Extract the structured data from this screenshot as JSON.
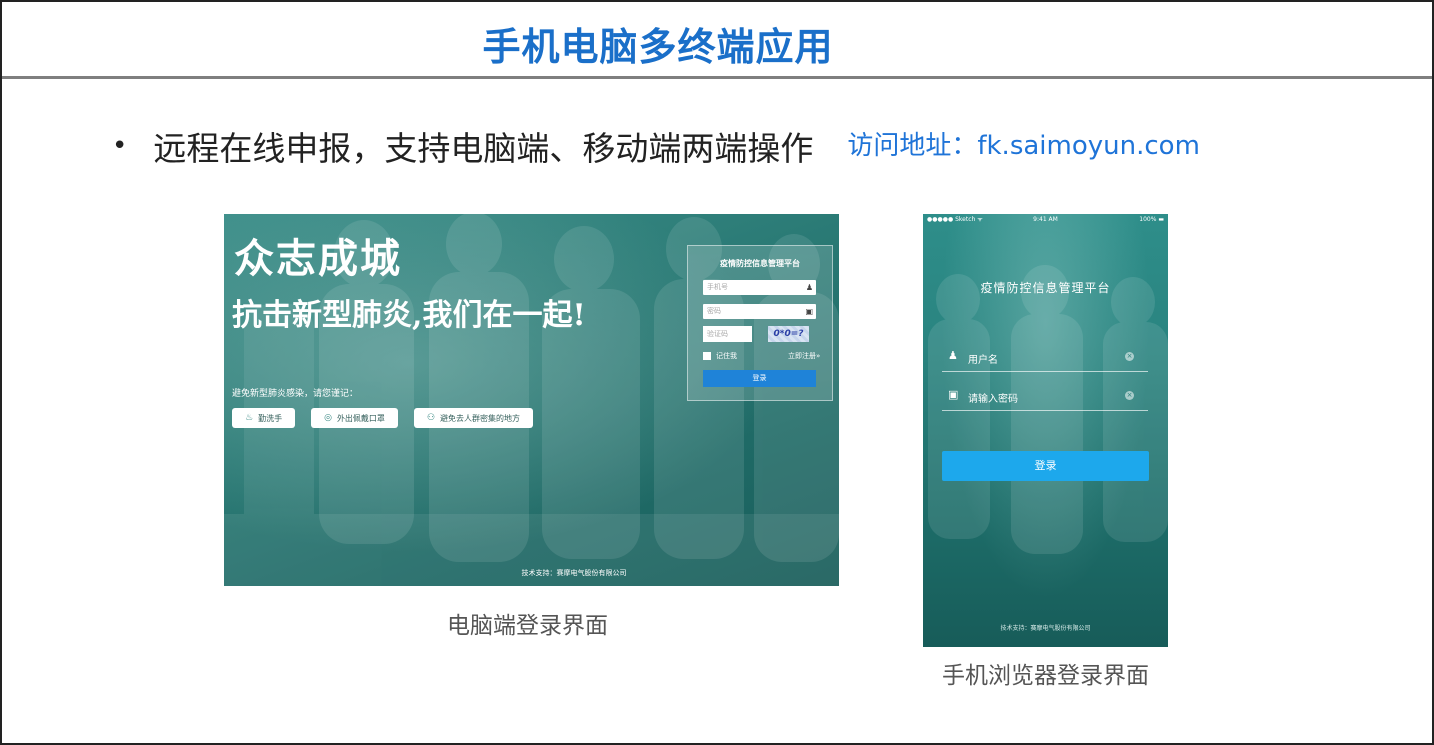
{
  "slide": {
    "title": "手机电脑多终端应用",
    "bullet": "•",
    "bullet_text": "远程在线申报，支持电脑端、移动端两端操作",
    "visit": "访问地址：fk.saimoyun.com"
  },
  "pc_screen": {
    "headline": "众志成城",
    "subheadline": "抗击新型肺炎,我们在一起!",
    "reminder": "避免新型肺炎感染，请您谨记：",
    "tips": [
      {
        "icon": "hand-wash-icon",
        "glyph": "♨",
        "label": "勤洗手"
      },
      {
        "icon": "mask-icon",
        "glyph": "◎",
        "label": "外出佩戴口罩"
      },
      {
        "icon": "crowd-icon",
        "glyph": "⚇",
        "label": "避免去人群密集的地方"
      }
    ],
    "login": {
      "title": "疫情防控信息管理平台",
      "phone_placeholder": "手机号",
      "password_placeholder": "密码",
      "captcha_placeholder": "验证码",
      "captcha_text": "0*0=?",
      "remember": "记住我",
      "register": "立即注册»",
      "login_button": "登录"
    },
    "support": "技术支持：赛摩电气股份有限公司",
    "caption": "电脑端登录界面"
  },
  "mobile_screen": {
    "status": {
      "carrier": "●●●●● Sketch ᯤ",
      "time": "9:41 AM",
      "battery": "100% ▬"
    },
    "title": "疫情防控信息管理平台",
    "username_placeholder": "用户名",
    "password_placeholder": "请输入密码",
    "clear_glyph": "×",
    "login_button": "登录",
    "support": "技术支持：赛摩电气股份有限公司",
    "caption": "手机浏览器登录界面"
  },
  "colors": {
    "title_blue": "#1a6fc9",
    "link_blue": "#1f74d8",
    "teal_background": "#2a7a75",
    "pc_login_button": "#1f83d8",
    "mobile_login_button": "#1da8ec"
  }
}
